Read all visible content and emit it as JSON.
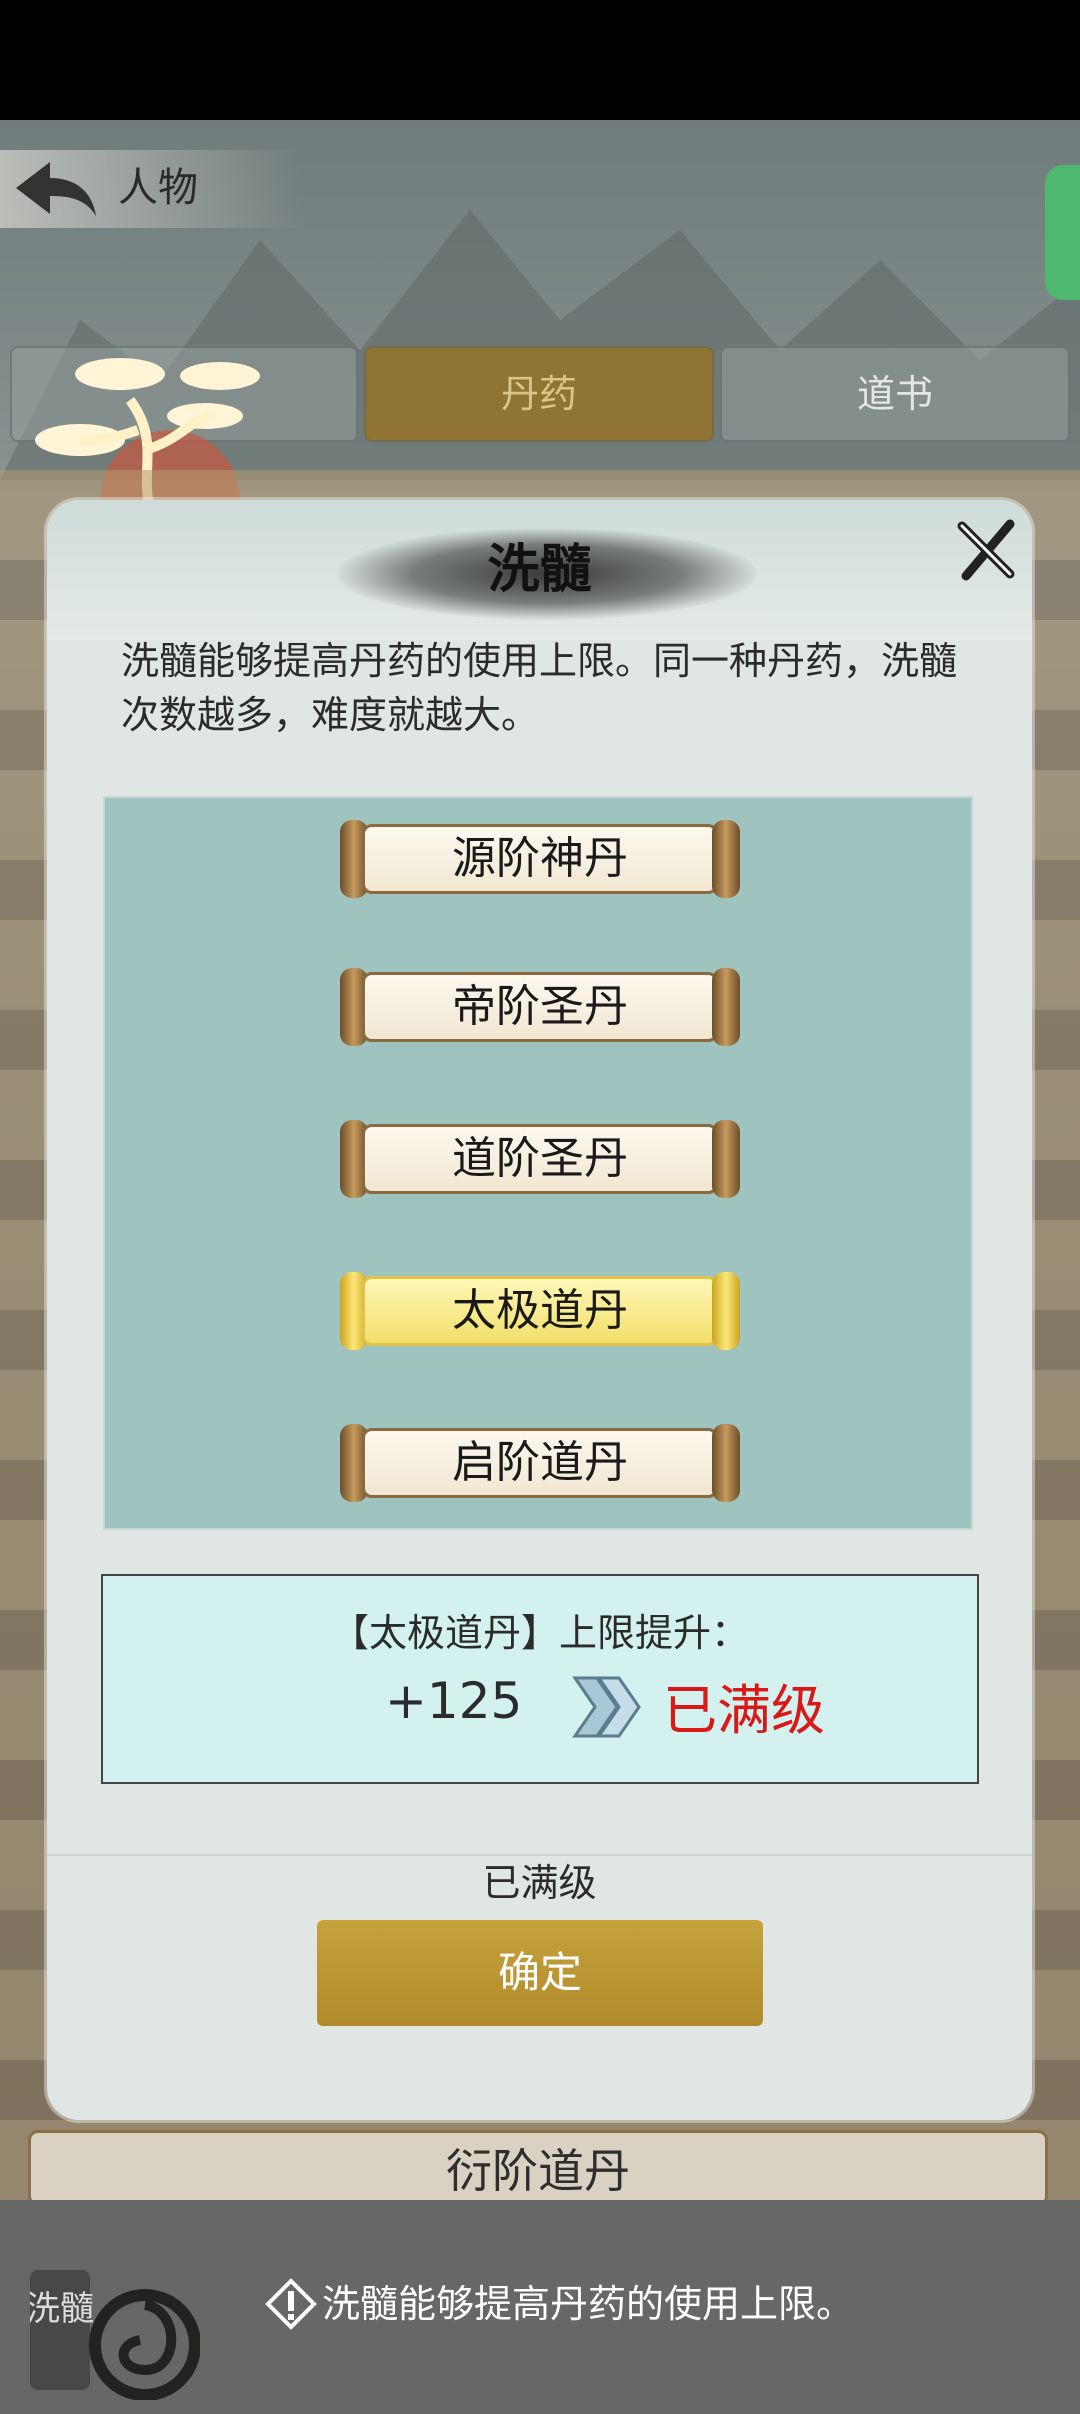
{
  "header": {
    "title": "人物"
  },
  "tabs": [
    {
      "label": ""
    },
    {
      "label": "丹药"
    },
    {
      "label": "道书"
    }
  ],
  "modal": {
    "title": "洗髓",
    "description": "洗髓能够提高丹药的使用上限。同一种丹药，洗髓次数越多，难度就越大。",
    "items": [
      {
        "label": "源阶神丹"
      },
      {
        "label": "帝阶圣丹"
      },
      {
        "label": "道阶圣丹"
      },
      {
        "label": "太极道丹",
        "selected": true
      },
      {
        "label": "启阶道丹"
      }
    ],
    "info": {
      "title": "【太极道丹】上限提升：",
      "value": "+125",
      "max_text": "已满级"
    },
    "status": "已满级",
    "confirm_label": "确定"
  },
  "background_list": {
    "partial_item": "衍阶道丹"
  },
  "bottom": {
    "skill_label": "洗髓",
    "hint": "洗髓能够提高丹药的使用上限。"
  },
  "colors": {
    "accent_gold": "#b8922e",
    "max_red": "#d91818",
    "panel_teal": "#9fc4c0"
  }
}
